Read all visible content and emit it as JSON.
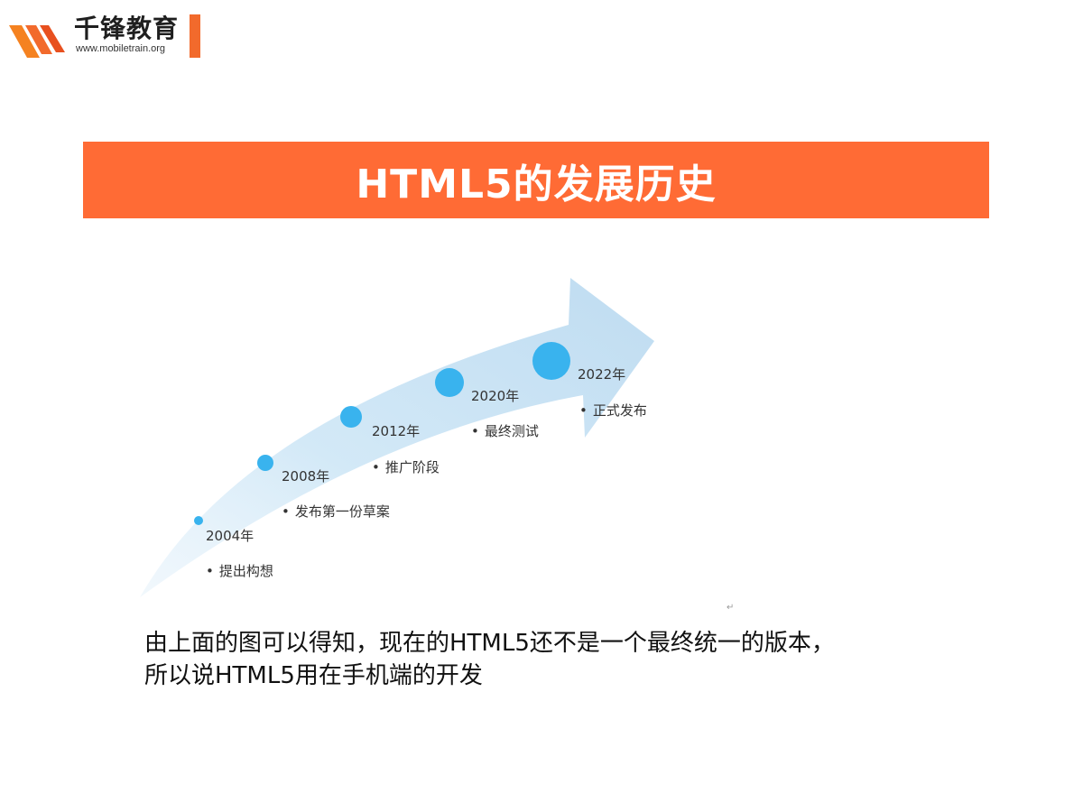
{
  "logo": {
    "brand_cn": "千锋教育",
    "url": "www.mobiletrain.org"
  },
  "slide": {
    "title": "HTML5的发展历史"
  },
  "timeline": {
    "milestones": [
      {
        "year": "2004年",
        "desc": "提出构想"
      },
      {
        "year": "2008年",
        "desc": "发布第一份草案"
      },
      {
        "year": "2012年",
        "desc": "推广阶段"
      },
      {
        "year": "2020年",
        "desc": "最终测试"
      },
      {
        "year": "2022年",
        "desc": "正式发布"
      }
    ],
    "bullet": "•",
    "corner_mark": "↵"
  },
  "summary": {
    "line1": "由上面的图可以得知，现在的HTML5还不是一个最终统一的版本，",
    "line2": "所以说HTML5用在手机端的开发"
  },
  "colors": {
    "accent": "#ff6b35",
    "arrow": "#cfe6f5",
    "dot": "#39b3ee"
  }
}
